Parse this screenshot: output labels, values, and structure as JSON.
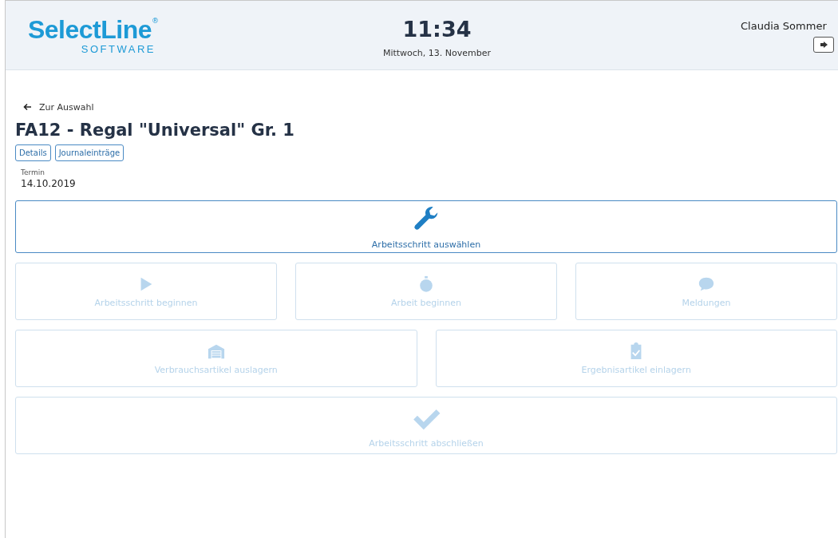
{
  "header": {
    "logo": {
      "name": "SelectLine",
      "mark": "®",
      "tagline": "SOFTWARE"
    },
    "time": "11:34",
    "date": "Mittwoch, 13. November",
    "user": "Claudia Sommer"
  },
  "back_link": "Zur Auswahl",
  "title": "FA12 - Regal \"Universal\" Gr. 1",
  "tabs": [
    {
      "label": "Details",
      "selected": false
    },
    {
      "label": "Journaleinträge",
      "selected": false
    }
  ],
  "field": {
    "label": "Termin",
    "value": "14.10.2019"
  },
  "action_rows": [
    [
      {
        "label": "Arbeitsschritt auswählen",
        "disabled": false
      }
    ],
    [
      {
        "label": "Arbeitsschritt beginnen",
        "disabled": true
      },
      {
        "label": "Arbeit beginnen",
        "disabled": true
      },
      {
        "label": "Meldungen",
        "disabled": true
      }
    ],
    [
      {
        "label": "Verbrauchsartikel auslagern",
        "disabled": true
      },
      {
        "label": "Ergebnisartikel einlagern",
        "disabled": true
      }
    ],
    [
      {
        "label": "Arbeitsschritt abschließen",
        "disabled": true
      }
    ]
  ]
}
